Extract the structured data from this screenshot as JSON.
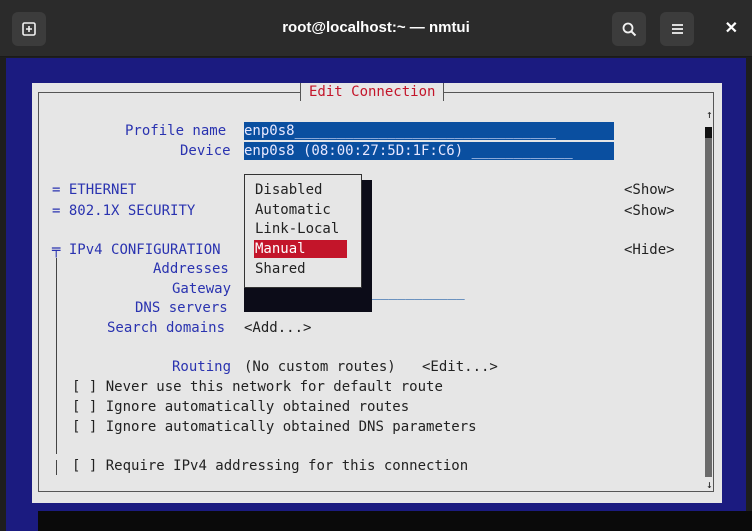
{
  "window": {
    "title": "root@localhost:~ — nmtui"
  },
  "dialog": {
    "title": "Edit Connection"
  },
  "profile": {
    "label": "Profile name",
    "value": "enp0s8",
    "fill": "_______________________________"
  },
  "device": {
    "label": "Device",
    "value": "enp0s8 (08:00:27:5D:1F:C6)",
    "fill": "____________"
  },
  "sections": {
    "ethernet": {
      "label": "ETHERNET",
      "action": "<Show>"
    },
    "security": {
      "label": "802.1X SECURITY",
      "action": "<Show>"
    },
    "ipv4": {
      "label": "IPv4 CONFIGURATION",
      "action": "<Hide>"
    }
  },
  "ipv4": {
    "addresses_label": "Addresses",
    "gateway_label": "Gateway",
    "gateway_fill": "___________",
    "dns_label": "DNS servers",
    "search_label": "Search domains",
    "search_action": "<Add...>",
    "routing_label": "Routing",
    "routing_value": "(No custom routes)",
    "routing_action": "<Edit...>"
  },
  "checkboxes": [
    {
      "mark": "[ ]",
      "label": "Never use this network for default route"
    },
    {
      "mark": "[ ]",
      "label": "Ignore automatically obtained routes"
    },
    {
      "mark": "[ ]",
      "label": "Ignore automatically obtained DNS parameters"
    },
    {
      "mark": "[ ]",
      "label": "Require IPv4 addressing for this connection"
    }
  ],
  "method_menu": {
    "options": [
      "Disabled",
      "Automatic",
      "Link-Local",
      "Manual",
      "Shared"
    ],
    "selected": "Manual"
  },
  "symbols": {
    "collapsed": "=",
    "expanded": "╤",
    "up": "↑",
    "down": "↓"
  },
  "colors": {
    "terminal_bg": "#1b1b80",
    "dialog_bg": "#e6e6e6",
    "field_bg": "#0a4fa0",
    "label_blue": "#2a33b0",
    "selected": "#c3152a"
  }
}
